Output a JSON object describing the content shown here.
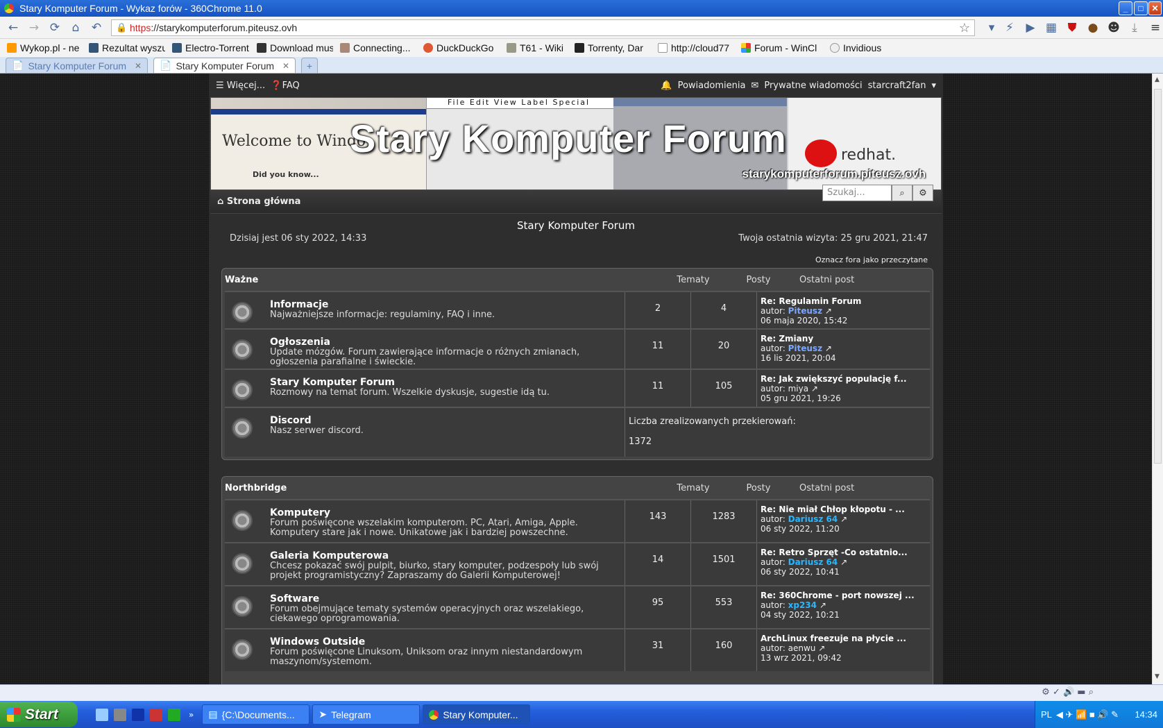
{
  "window": {
    "title": "Stary Komputer Forum - Wykaz forów - 360Chrome 11.0"
  },
  "address": {
    "scheme": "https",
    "rest": "://starykomputerforum.piteusz.ovh"
  },
  "bookmarks": [
    "Wykop.pl - ne",
    "Rezultat wyszu",
    "Electro-Torrent",
    "Download mus",
    "Connecting...",
    "DuckDuckGo",
    "T61 - Wiki",
    "Torrenty, Dar",
    "http://cloud77",
    "Forum - WinCl",
    "Invidious"
  ],
  "tabs": [
    {
      "label": "Stary Komputer Forum"
    },
    {
      "label": "Stary Komputer Forum"
    }
  ],
  "forum": {
    "topnav": {
      "more": "Więcej...",
      "faq": "FAQ",
      "notifications": "Powiadomienia",
      "pm": "Prywatne wiadomości",
      "user": "starcraft2fan"
    },
    "banner": {
      "title": "Stary Komputer Forum",
      "url": "starykomputerforum.piteusz.ovh",
      "welcome": "Welcome to Windo",
      "didyou": "Did you know...",
      "mac_menu": "File  Edit  View  Label  Special",
      "redhat": "redhat."
    },
    "home": "Strona główna",
    "search_placeholder": "Szukaj...",
    "title": "Stary Komputer Forum",
    "today": "Dzisiaj jest 06 sty 2022, 14:33",
    "last_visit": "Twoja ostatnia wizyta: 25 gru 2021, 21:47",
    "mark_read": "Oznacz fora jako przeczytane",
    "col_topics": "Tematy",
    "col_posts": "Posty",
    "col_last": "Ostatni post",
    "cat1": {
      "name": "Ważne",
      "rows": [
        {
          "title": "Informacje",
          "desc": "Najważniejsze informacje: regulaminy, FAQ i inne.",
          "topics": "2",
          "posts": "4",
          "last_title": "Re: Regulamin Forum",
          "author_prefix": "autor:",
          "author": "Piteusz",
          "date": "06 maja 2020, 15:42"
        },
        {
          "title": "Ogłoszenia",
          "desc": "Update mózgów. Forum zawierające informacje o różnych zmianach, ogłoszenia parafialne i świeckie.",
          "topics": "11",
          "posts": "20",
          "last_title": "Re: Zmiany",
          "author_prefix": "autor:",
          "author": "Piteusz",
          "date": "16 lis 2021, 20:04"
        },
        {
          "title": "Stary Komputer Forum",
          "desc": "Rozmowy na temat forum. Wszelkie dyskusje, sugestie idą tu.",
          "topics": "11",
          "posts": "105",
          "last_title": "Re: Jak zwiększyć populację f...",
          "author_prefix": "autor:",
          "author": "miya",
          "date": "05 gru 2021, 19:26"
        },
        {
          "title": "Discord",
          "desc": "Nasz serwer discord.",
          "redirect_label": "Liczba zrealizowanych przekierowań:",
          "redirect_count": "1372"
        }
      ]
    },
    "cat2": {
      "name": "Northbridge",
      "rows": [
        {
          "title": "Komputery",
          "desc": "Forum poświęcone wszelakim komputerom. PC, Atari, Amiga, Apple. Komputery stare jak i nowe. Unikatowe jak i bardziej powszechne.",
          "topics": "143",
          "posts": "1283",
          "last_title": "Re: Nie miał Chłop kłopotu - ...",
          "author_prefix": "autor:",
          "author": "Dariusz 64",
          "date": "06 sty 2022, 11:20"
        },
        {
          "title": "Galeria Komputerowa",
          "desc": "Chcesz pokazać swój pulpit, biurko, stary komputer, podzespoły lub swój projekt programistyczny? Zapraszamy do Galerii Komputerowej!",
          "topics": "14",
          "posts": "1501",
          "last_title": "Re: Retro Sprzęt -Co ostatnio...",
          "author_prefix": "autor:",
          "author": "Dariusz 64",
          "date": "06 sty 2022, 10:41"
        },
        {
          "title": "Software",
          "desc": "Forum obejmujące tematy systemów operacyjnych oraz wszelakiego, ciekawego oprogramowania.",
          "topics": "95",
          "posts": "553",
          "last_title": "Re: 360Chrome - port nowszej ...",
          "author_prefix": "autor:",
          "author": "xp234",
          "date": "04 sty 2022, 10:21"
        },
        {
          "title": "Windows Outside",
          "desc": "Forum poświęcone Linuksom, Uniksom oraz innym niestandardowym maszynom/systemom.",
          "topics": "31",
          "posts": "160",
          "last_title": "ArchLinux freezuje na płycie ...",
          "author_prefix": "autor:",
          "author": "aenwu",
          "date": "13 wrz 2021, 09:42"
        }
      ]
    }
  },
  "taskbar": {
    "start": "Start",
    "tasks": [
      "{C:\\Documents...",
      "Telegram",
      "Stary Komputer..."
    ],
    "lang": "PL",
    "time": "14:34"
  }
}
